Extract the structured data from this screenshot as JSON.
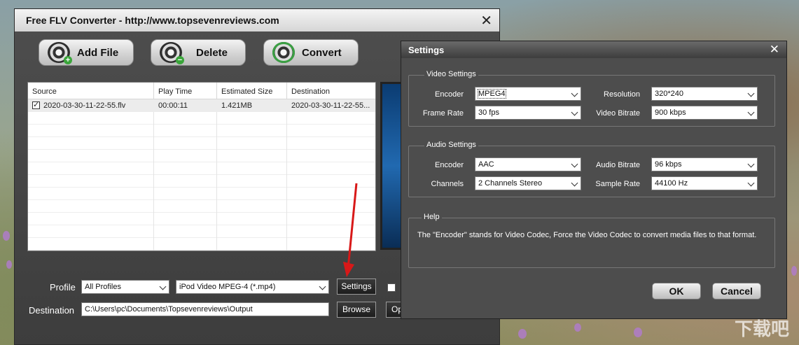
{
  "main_window": {
    "title": "Free FLV Converter - http://www.topsevenreviews.com",
    "close_glyph": "✕",
    "toolbar": {
      "add_file": "Add File",
      "delete": "Delete",
      "convert": "Convert",
      "icons": [
        "film-reel-add-icon",
        "film-reel-delete-icon",
        "film-reel-convert-icon"
      ]
    },
    "file_list": {
      "columns": [
        "Source",
        "Play Time",
        "Estimated Size",
        "Destination"
      ],
      "rows": [
        {
          "checked": true,
          "source": "2020-03-30-11-22-55.flv",
          "play_time": "00:00:11",
          "size": "1.421MB",
          "destination": "2020-03-30-11-22-55..."
        }
      ]
    },
    "profile": {
      "label": "Profile",
      "category": "All Profiles",
      "format": "iPod Video MPEG-4 (*.mp4)",
      "settings_button": "Settings"
    },
    "destination": {
      "label": "Destination",
      "path": "C:\\Users\\pc\\Documents\\Topsevenreviews\\Output",
      "browse_button": "Browse",
      "open_button_partial": "Op"
    }
  },
  "settings_dialog": {
    "title": "Settings",
    "close_glyph": "✕",
    "video": {
      "group_title": "Video Settings",
      "encoder_label": "Encoder",
      "encoder": "MPEG4",
      "resolution_label": "Resolution",
      "resolution": "320*240",
      "frame_rate_label": "Frame Rate",
      "frame_rate": "30 fps",
      "bitrate_label": "Video Bitrate",
      "bitrate": "900 kbps"
    },
    "audio": {
      "group_title": "Audio Settings",
      "encoder_label": "Encoder",
      "encoder": "AAC",
      "bitrate_label": "Audio Bitrate",
      "bitrate": "96 kbps",
      "channels_label": "Channels",
      "channels": "2 Channels Stereo",
      "sample_rate_label": "Sample Rate",
      "sample_rate": "44100 Hz"
    },
    "help": {
      "group_title": "Help",
      "text": "The \"Encoder\" stands for Video Codec, Force the Video Codec to convert media files to that format."
    },
    "ok_button": "OK",
    "cancel_button": "Cancel"
  },
  "watermark": "下载吧",
  "colors": {
    "arrow": "#d81818",
    "dialog_bg": "#4d4d4d",
    "window_bg": "#444444"
  }
}
